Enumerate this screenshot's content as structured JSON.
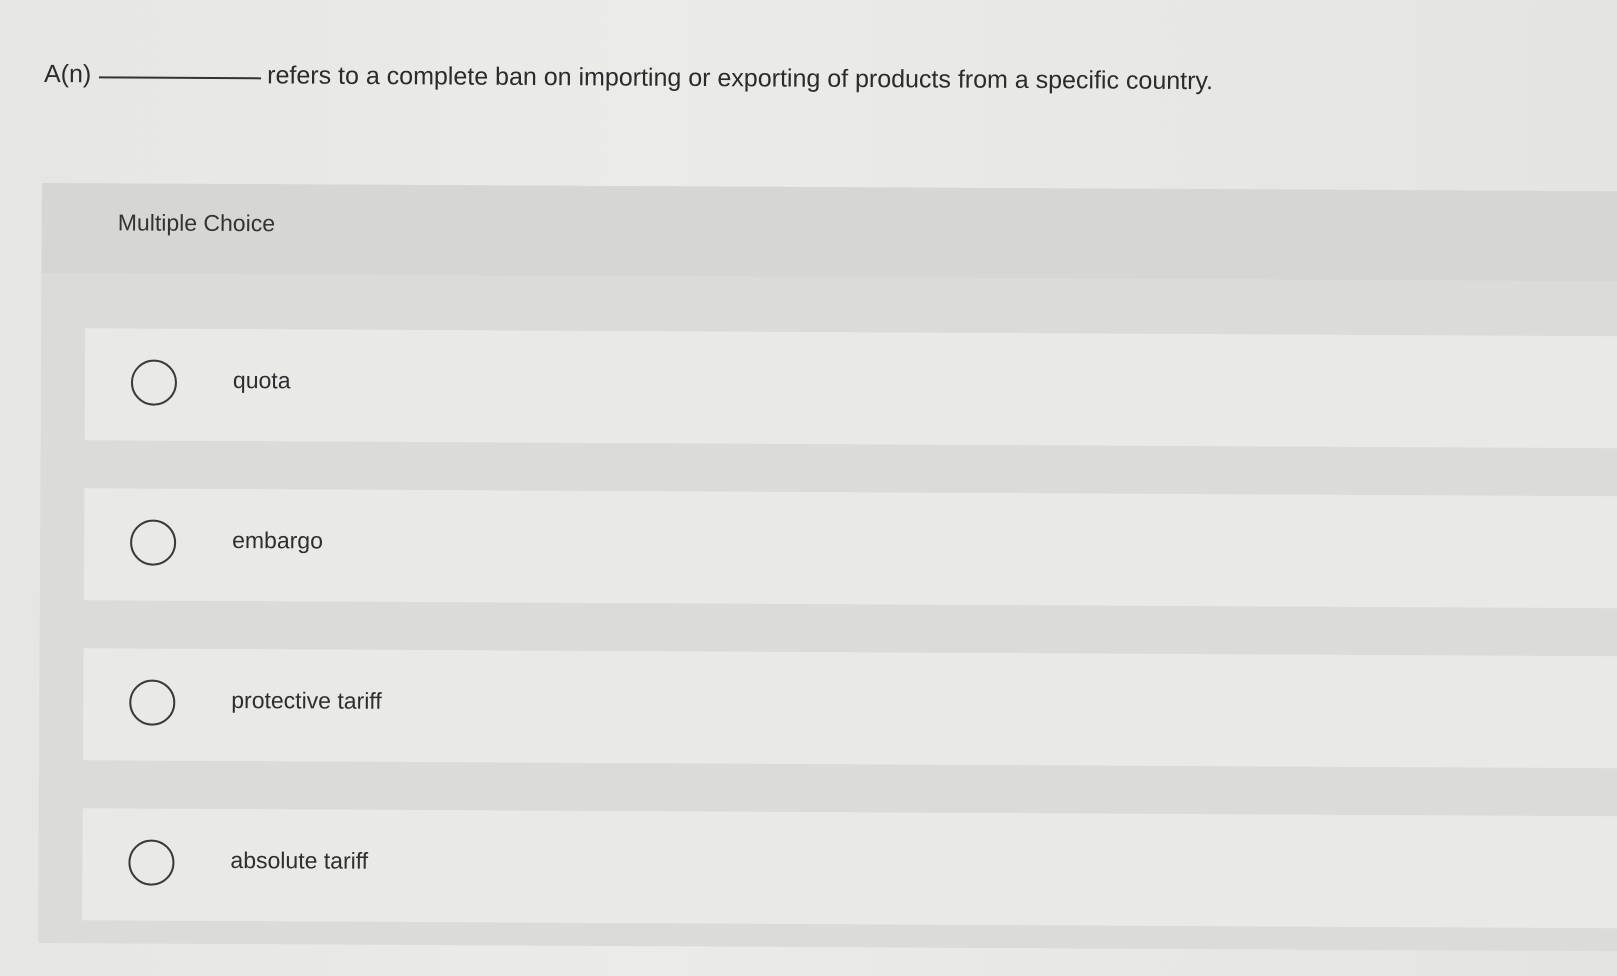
{
  "question": {
    "prefix": "A(n)",
    "suffix": "refers to a complete ban on importing or exporting of products from a specific country."
  },
  "multiple_choice": {
    "label": "Multiple Choice",
    "options": [
      {
        "label": "quota"
      },
      {
        "label": "embargo"
      },
      {
        "label": "protective tariff"
      },
      {
        "label": "absolute tariff"
      }
    ]
  }
}
